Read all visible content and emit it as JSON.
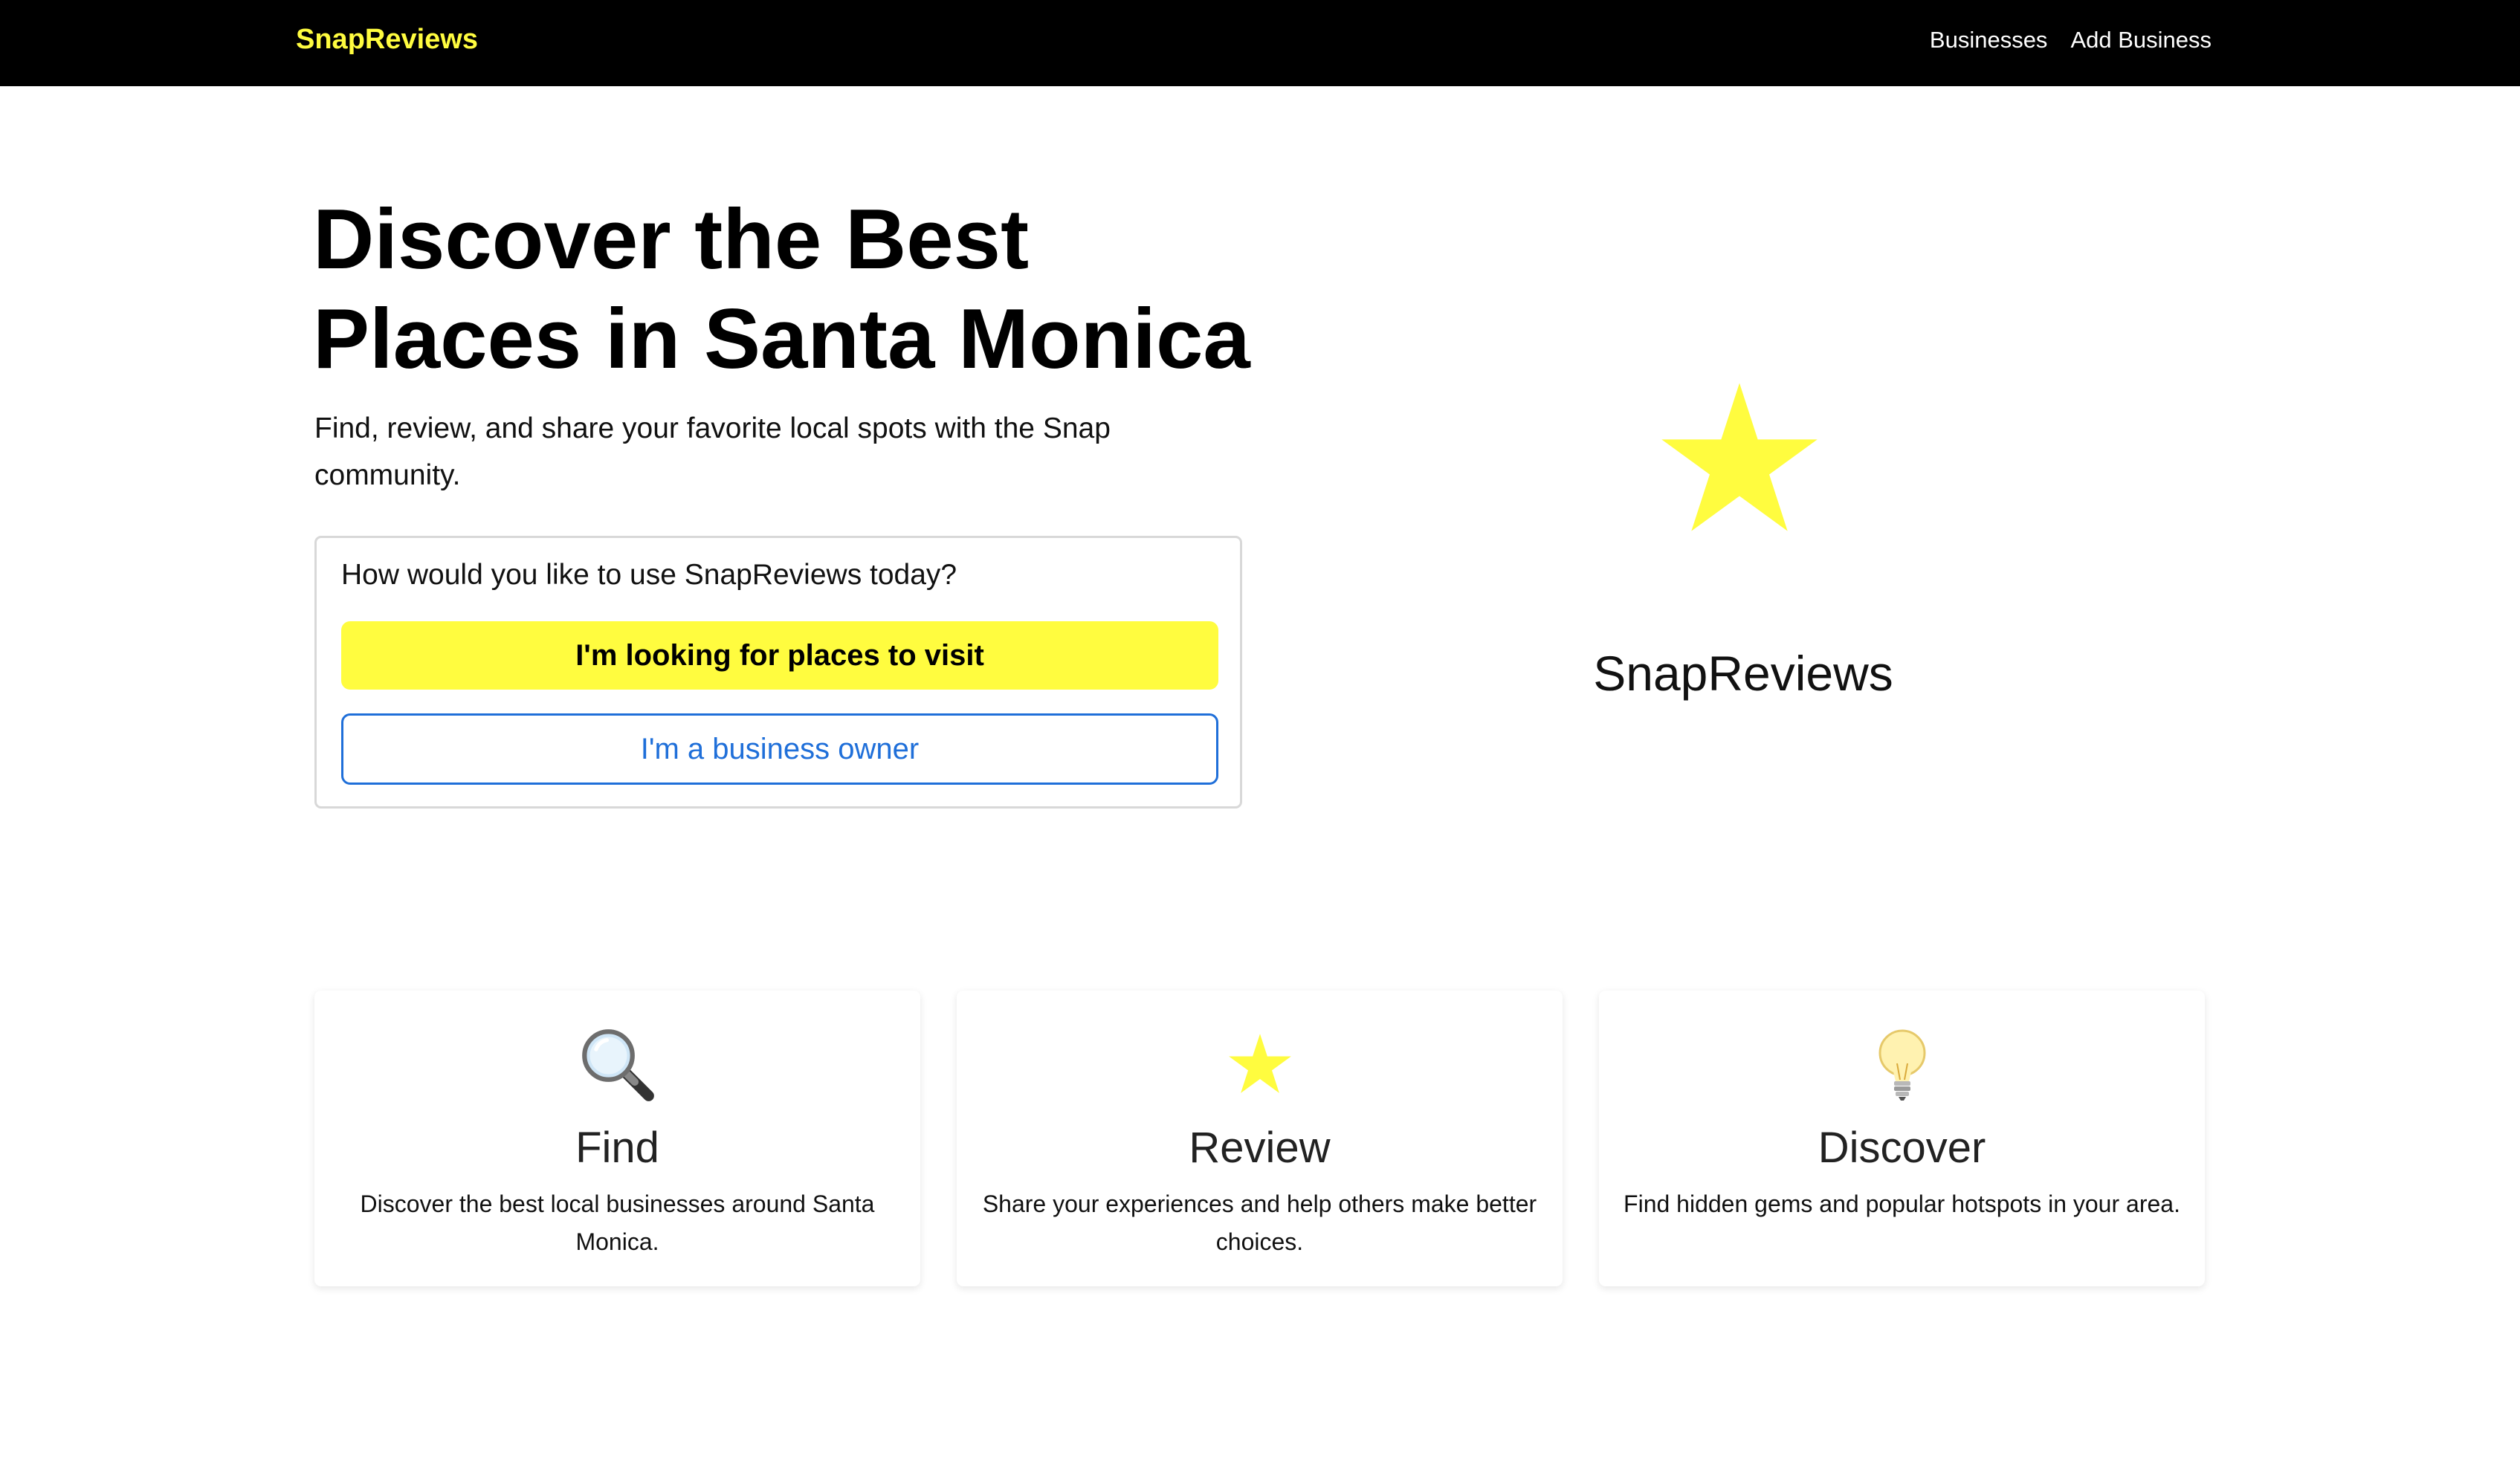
{
  "nav": {
    "brand": "SnapReviews",
    "links": [
      "Businesses",
      "Add Business"
    ]
  },
  "hero": {
    "title": "Discover the Best Places in Santa Monica",
    "subtitle": "Find, review, and share your favorite local spots with the Snap community.",
    "choice": {
      "prompt": "How would you like to use SnapReviews today?",
      "primary_button": "I'm looking for places to visit",
      "secondary_button": "I'm a business owner"
    }
  },
  "logo": {
    "text": "SnapReviews",
    "icon": "star-icon"
  },
  "features": [
    {
      "icon": "magnifying-glass-icon",
      "title": "Find",
      "description": "Discover the best local businesses around Santa Monica."
    },
    {
      "icon": "star-icon",
      "title": "Review",
      "description": "Share your experiences and help others make better choices."
    },
    {
      "icon": "lightbulb-icon",
      "title": "Discover",
      "description": "Find hidden gems and popular hotspots in your area."
    }
  ],
  "colors": {
    "brand_yellow": "#fffc3f",
    "navbar_bg": "#000000",
    "link_blue": "#1f6fd9"
  }
}
